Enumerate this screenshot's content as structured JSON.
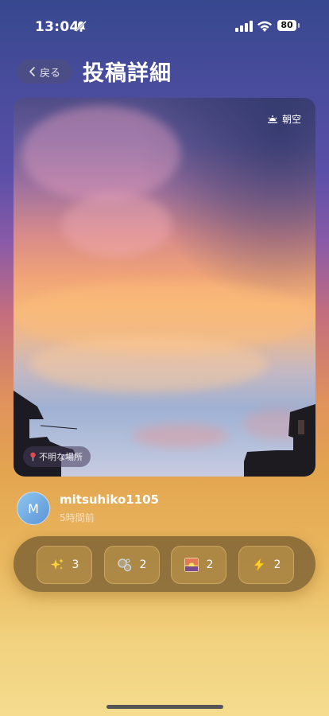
{
  "status_bar": {
    "time": "13:04",
    "battery": "80"
  },
  "header": {
    "back_label": "戻る",
    "title": "投稿詳細"
  },
  "photo": {
    "category_tag": "朝空",
    "location_tag": "不明な場所"
  },
  "author": {
    "avatar_initial": "M",
    "username": "mitsuhiko1105",
    "time_ago": "5時間前"
  },
  "reactions": [
    {
      "icon": "sparkles-icon",
      "count": "3"
    },
    {
      "icon": "bubbles-icon",
      "count": "2"
    },
    {
      "icon": "sunset-photo-icon",
      "count": "2"
    },
    {
      "icon": "lightning-icon",
      "count": "2"
    }
  ]
}
